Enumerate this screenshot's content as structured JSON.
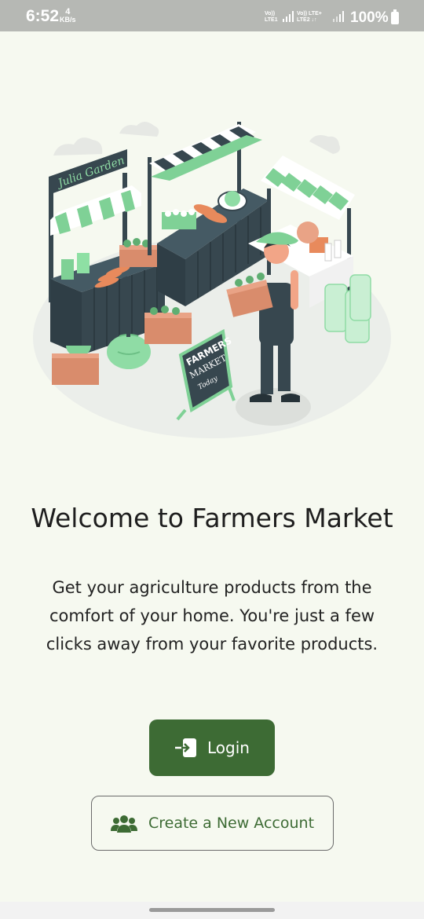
{
  "status": {
    "time": "6:52",
    "speed_value": "4",
    "speed_unit": "KB/s",
    "sim1_line1": "Vo)) ",
    "sim1_line2": "LTE1",
    "sim2_line1": "Vo)) LTE+",
    "sim2_line2": "LTE2 ↓↑",
    "battery": "100%"
  },
  "illustration": {
    "stall_sign": "Julia Garden",
    "chalkboard_line1": "FARMERS",
    "chalkboard_line2": "MARKET",
    "chalkboard_line3": "Today"
  },
  "welcome": {
    "title": "Welcome to Farmers Market",
    "description_line1": "Get your agriculture products from the",
    "description_line2": "comfort of your home. You're just a few",
    "description_line3": "clicks away from your favorite products."
  },
  "actions": {
    "login_label": "Login",
    "login_icon": "login-icon",
    "create_account_label": "Create a New Account",
    "create_account_icon": "users-icon"
  },
  "colors": {
    "primary": "#3d6b34",
    "accent_green": "#7fd196",
    "dark_stall": "#37474f",
    "background": "#f6f9f0"
  }
}
